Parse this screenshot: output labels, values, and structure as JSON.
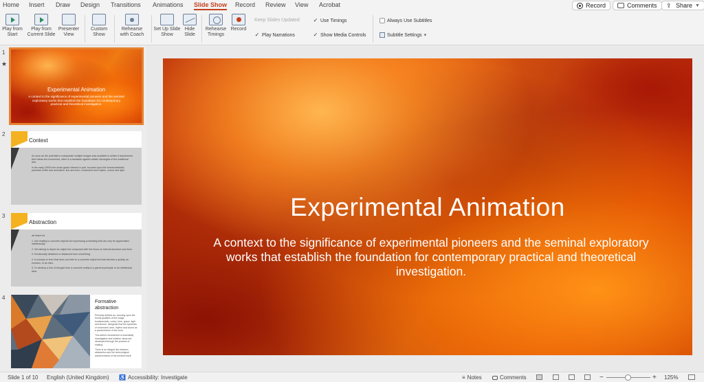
{
  "tabs": [
    "Home",
    "Insert",
    "Draw",
    "Design",
    "Transitions",
    "Animations",
    "Slide Show",
    "Record",
    "Review",
    "View",
    "Acrobat"
  ],
  "active_tab": "Slide Show",
  "top_buttons": {
    "record": "Record",
    "comments": "Comments",
    "share": "Share"
  },
  "ribbon": {
    "play_from_start": "Play from Start",
    "play_from_current": "Play from Current Slide",
    "presenter_view": "Presenter View",
    "custom_show": "Custom Show",
    "rehearse_with_coach": "Rehearse with Coach",
    "set_up_slide_show": "Set Up Slide Show",
    "hide_slide": "Hide Slide",
    "rehearse_timings": "Rehearse Timings",
    "record": "Record",
    "keep_slides_updated": "Keep Slides Updated",
    "play_narrations": "Play Narrations",
    "use_timings": "Use Timings",
    "show_media_controls": "Show Media Controls",
    "always_use_subtitles": "Always Use Subtitles",
    "subtitle_settings": "Subtitle Settings"
  },
  "slides": [
    {
      "number": "1",
      "title": "Experimental Animation",
      "subtitle": "A context to the significance of experimental pioneers and the seminal exploratory works that establish the foundation for contemporary practical and theoretical investigation."
    },
    {
      "number": "2",
      "title": "Context",
      "body": [
        "As soon as the potential to manipulate multiple images was available to artists it transformed their ideas into movement, often in a backlash against artistic ideologies of the traditional arts.",
        "In the early 1900's the avant garde interest in part, focused upon the formal aesthetic potential of film and animation, line and form, movement and rhythm, colour and light."
      ]
    },
    {
      "number": "3",
      "title": "Abstraction",
      "lead": "ab·stract·ed",
      "body": [
        "1. Not relating to concrete objects but expressing something that can only be appreciated intellectually.",
        "2. Not aiming to depict an object but composed with the focus on internal structure and form.",
        "3. Emotionally detached or distanced from something.",
        "4. A concept or term that does not refer to a concrete object but that denotes a quality, an emotion, or an idea.",
        "5. To develop a line of thought from a concrete reality to a general principle or an intellectual idea."
      ]
    },
    {
      "number": "4",
      "title": "Formative abstraction",
      "body": [
        "Primarily defined as, focusing upon the formal qualities of the image - fundamentals, colour, form, space, light and texture, alongside that the dynamics of movement, time, rhythm and sound as a pivotal theme of the work.",
        "This artist's involvement is essentially investigative and intuitive; ideas are developed through the process of making.",
        "There is an integral link between abstraction and the technological advancements of the medium itself."
      ]
    }
  ],
  "status": {
    "slide_indicator": "Slide 1 of 10",
    "language": "English (United Kingdom)",
    "accessibility": "Accessibility: Investigate",
    "notes": "Notes",
    "comments": "Comments",
    "zoom_minus": "−",
    "zoom_plus": "+",
    "zoom_level": "125%"
  },
  "colors": {
    "accent": "#c43e1c",
    "selection": "#e6812f",
    "slide_yellow": "#f4b120"
  }
}
